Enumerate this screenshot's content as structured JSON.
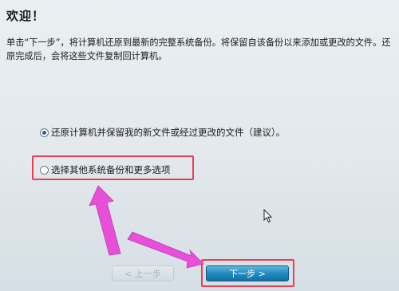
{
  "wizard": {
    "title": "欢迎！",
    "description": "单击“下一步”，将计算机还原到最新的完整系统备份。将保留自该备份以来添加或更改的文件。还原完成后，会将这些文件复制回计算机。",
    "options": [
      {
        "label": "还原计算机并保留我的新文件或经过更改的文件（建议）。",
        "selected": true
      },
      {
        "label": "选择其他系统备份和更多选项",
        "selected": false
      }
    ],
    "buttons": {
      "back_label": "< 上一步",
      "next_label": "下一步 >"
    }
  },
  "colors": {
    "highlight": "#ec3f55",
    "arrow": "#e84fd8",
    "next_button": "#1f8cc2"
  }
}
